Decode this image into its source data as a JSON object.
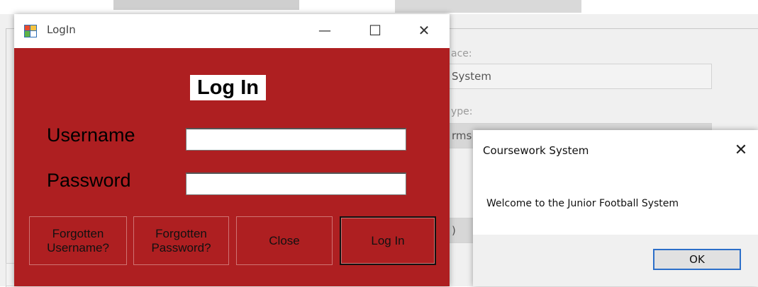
{
  "background": {
    "field_labels": [
      "ace:",
      "ype:"
    ],
    "field_values": [
      "System",
      "rms",
      ")"
    ]
  },
  "login_window": {
    "title": "LogIn",
    "minimize_glyph": "—",
    "maximize_glyph": "☐",
    "close_glyph": "✕",
    "heading": "Log In",
    "username_label": "Username",
    "password_label": "Password",
    "username_value": "",
    "password_value": "",
    "buttons": {
      "forgot_username": "Forgotten\nUsername?",
      "forgot_password": "Forgotten\nPassword?",
      "close": "Close",
      "login": "Log In"
    },
    "body_color": "#ae1f21"
  },
  "message_box": {
    "title": "Coursework System",
    "close_glyph": "✕",
    "message": "Welcome to the Junior Football System",
    "ok_label": "OK",
    "accent": "#2c6fc9"
  }
}
